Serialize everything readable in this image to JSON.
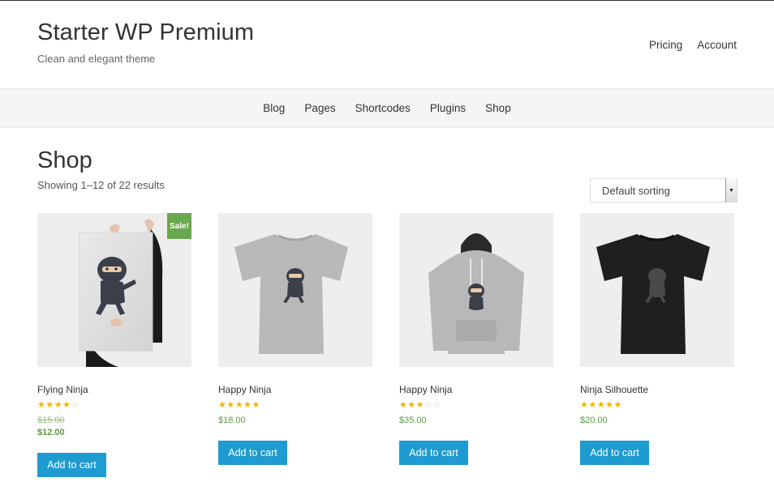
{
  "site": {
    "title": "Starter WP Premium",
    "tagline": "Clean and elegant theme",
    "top_menu": [
      "Pricing",
      "Account"
    ]
  },
  "nav": {
    "items": [
      "Blog",
      "Pages",
      "Shortcodes",
      "Plugins",
      "Shop"
    ]
  },
  "shop": {
    "title": "Shop",
    "result_count": "Showing 1–12 of 22 results",
    "sorting": {
      "selected": "Default sorting",
      "arrow": "▼"
    }
  },
  "products": [
    {
      "name": "Flying Ninja",
      "rating": 4,
      "old_price": "$15.00",
      "price": "$12.00",
      "on_sale": true,
      "sale_label": "Sale!",
      "button": "Add to cart",
      "image": "poster-icon"
    },
    {
      "name": "Happy Ninja",
      "rating": 5,
      "price": "$18.00",
      "button": "Add to cart",
      "image": "tshirt-grey-icon"
    },
    {
      "name": "Happy Ninja",
      "rating": 3,
      "price": "$35.00",
      "button": "Add to cart",
      "image": "hoodie-icon"
    },
    {
      "name": "Ninja Silhouette",
      "rating": 5,
      "price": "$20.00",
      "button": "Add to cart",
      "image": "tshirt-black-icon"
    }
  ],
  "colors": {
    "button": "#1e9bd0",
    "sale": "#6aa84f",
    "price": "#5a9b3e",
    "stars": "#f0b400"
  }
}
